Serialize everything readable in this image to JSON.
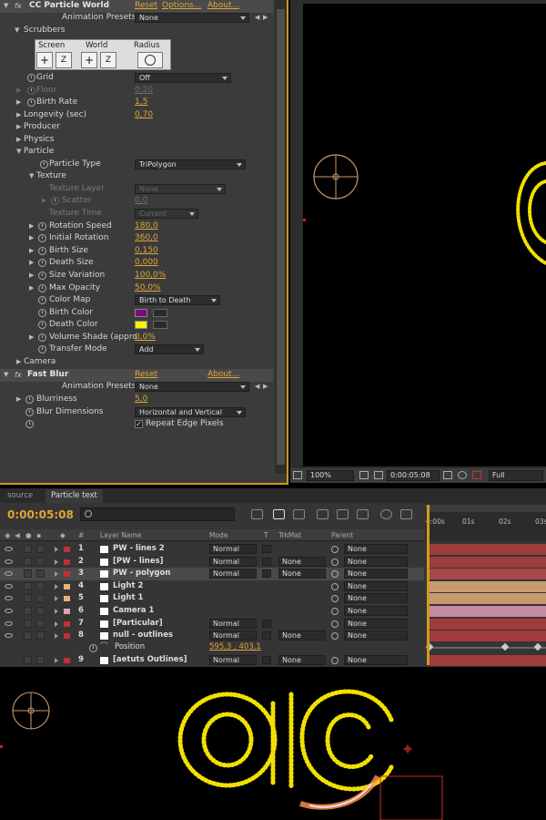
{
  "effect1": {
    "name": "CC Particle World",
    "reset": "Reset",
    "options": "Options...",
    "about": "About...",
    "presets_label": "Animation Presets:",
    "presets_value": "None"
  },
  "scrubbers": {
    "label": "Scrubbers",
    "screen": "Screen",
    "world": "World",
    "radius": "Radius",
    "plus": "+",
    "z": "Z"
  },
  "props": {
    "grid": {
      "label": "Grid",
      "value": "Off"
    },
    "floor": {
      "label": "Floor",
      "value": "0,20"
    },
    "birth_rate": {
      "label": "Birth Rate",
      "value": "1,5"
    },
    "longevity": {
      "label": "Longevity (sec)",
      "value": "0,70"
    },
    "producer": {
      "label": "Producer"
    },
    "physics": {
      "label": "Physics"
    },
    "particle": {
      "label": "Particle"
    },
    "particle_type": {
      "label": "Particle Type",
      "value": "TriPolygon"
    },
    "texture": {
      "label": "Texture"
    },
    "texture_layer": {
      "label": "Texture Layer",
      "value": "None"
    },
    "scatter": {
      "label": "Scatter",
      "value": "0,0"
    },
    "texture_time": {
      "label": "Texture Time",
      "value": "Current"
    },
    "rotation_speed": {
      "label": "Rotation Speed",
      "value": "180,0"
    },
    "initial_rotation": {
      "label": "Initial Rotation",
      "value": "360,0"
    },
    "birth_size": {
      "label": "Birth Size",
      "value": "0,150"
    },
    "death_size": {
      "label": "Death Size",
      "value": "0,000"
    },
    "size_variation": {
      "label": "Size Variation",
      "value": "100,0%"
    },
    "max_opacity": {
      "label": "Max Opacity",
      "value": "50,0%"
    },
    "color_map": {
      "label": "Color Map",
      "value": "Birth to Death"
    },
    "birth_color": {
      "label": "Birth Color",
      "color": "#7a0a7a"
    },
    "death_color": {
      "label": "Death Color",
      "color": "#f7f200"
    },
    "volume_shade": {
      "label": "Volume Shade (appro",
      "value": "0,0%"
    },
    "transfer_mode": {
      "label": "Transfer Mode",
      "value": "Add"
    },
    "camera": {
      "label": "Camera"
    }
  },
  "effect2": {
    "name": "Fast Blur",
    "reset": "Reset",
    "about": "About...",
    "presets_label": "Animation Presets:",
    "presets_value": "None",
    "blurriness": {
      "label": "Blurriness",
      "value": "5,0"
    },
    "blur_dimensions": {
      "label": "Blur Dimensions",
      "value": "Horizontal and Vertical"
    },
    "repeat_edge": {
      "label": "Repeat Edge Pixels",
      "checked": "✓"
    }
  },
  "viewer": {
    "zoom": "100%",
    "timecode": "0:00:05:08",
    "resolution": "Full"
  },
  "timeline": {
    "tabs": [
      "source",
      "Particle text"
    ],
    "timecode": "0:00:05:08",
    "columns": {
      "num": "#",
      "layer_name": "Layer Name",
      "mode": "Mode",
      "t": "T",
      "trkmat": "TrkMat",
      "parent": "Parent"
    },
    "ruler": [
      "0:00s",
      "01s",
      "02s",
      "03s"
    ],
    "layers": [
      {
        "num": "1",
        "name": "PW - lines 2",
        "mode": "Normal",
        "trkmat": "",
        "parent": "None",
        "label": "#c03030",
        "bar": "#9e3b3b"
      },
      {
        "num": "2",
        "name": "[PW - lines]",
        "mode": "Normal",
        "trkmat": "None",
        "parent": "None",
        "label": "#c03030",
        "bar": "#9e3b3b"
      },
      {
        "num": "3",
        "name": "PW - polygon",
        "mode": "Normal",
        "trkmat": "None",
        "parent": "None",
        "label": "#c03030",
        "bar": "#a84848"
      },
      {
        "num": "4",
        "name": "Light 2",
        "mode": "",
        "trkmat": "",
        "parent": "None",
        "label": "#e8b07a",
        "bar": "#c79a6e"
      },
      {
        "num": "5",
        "name": "Light 1",
        "mode": "",
        "trkmat": "",
        "parent": "None",
        "label": "#e8b07a",
        "bar": "#c79a6e"
      },
      {
        "num": "6",
        "name": "Camera 1",
        "mode": "",
        "trkmat": "",
        "parent": "None",
        "label": "#e0a0b8",
        "bar": "#c58a9f"
      },
      {
        "num": "7",
        "name": "[Particular]",
        "mode": "Normal",
        "trkmat": "",
        "parent": "None",
        "label": "#c03030",
        "bar": "#9e3b3b"
      },
      {
        "num": "8",
        "name": "null - outlines",
        "mode": "Normal",
        "trkmat": "None",
        "parent": "None",
        "label": "#c03030",
        "bar": "#9e3b3b"
      }
    ],
    "position": {
      "label": "Position",
      "value": "595,3 , 403,1"
    },
    "layer9": {
      "num": "9",
      "name": "[aetuts Outlines]",
      "mode": "Normal",
      "trkmat": "None",
      "parent": "None",
      "label": "#c03030",
      "bar": "#9e3b3b"
    }
  }
}
